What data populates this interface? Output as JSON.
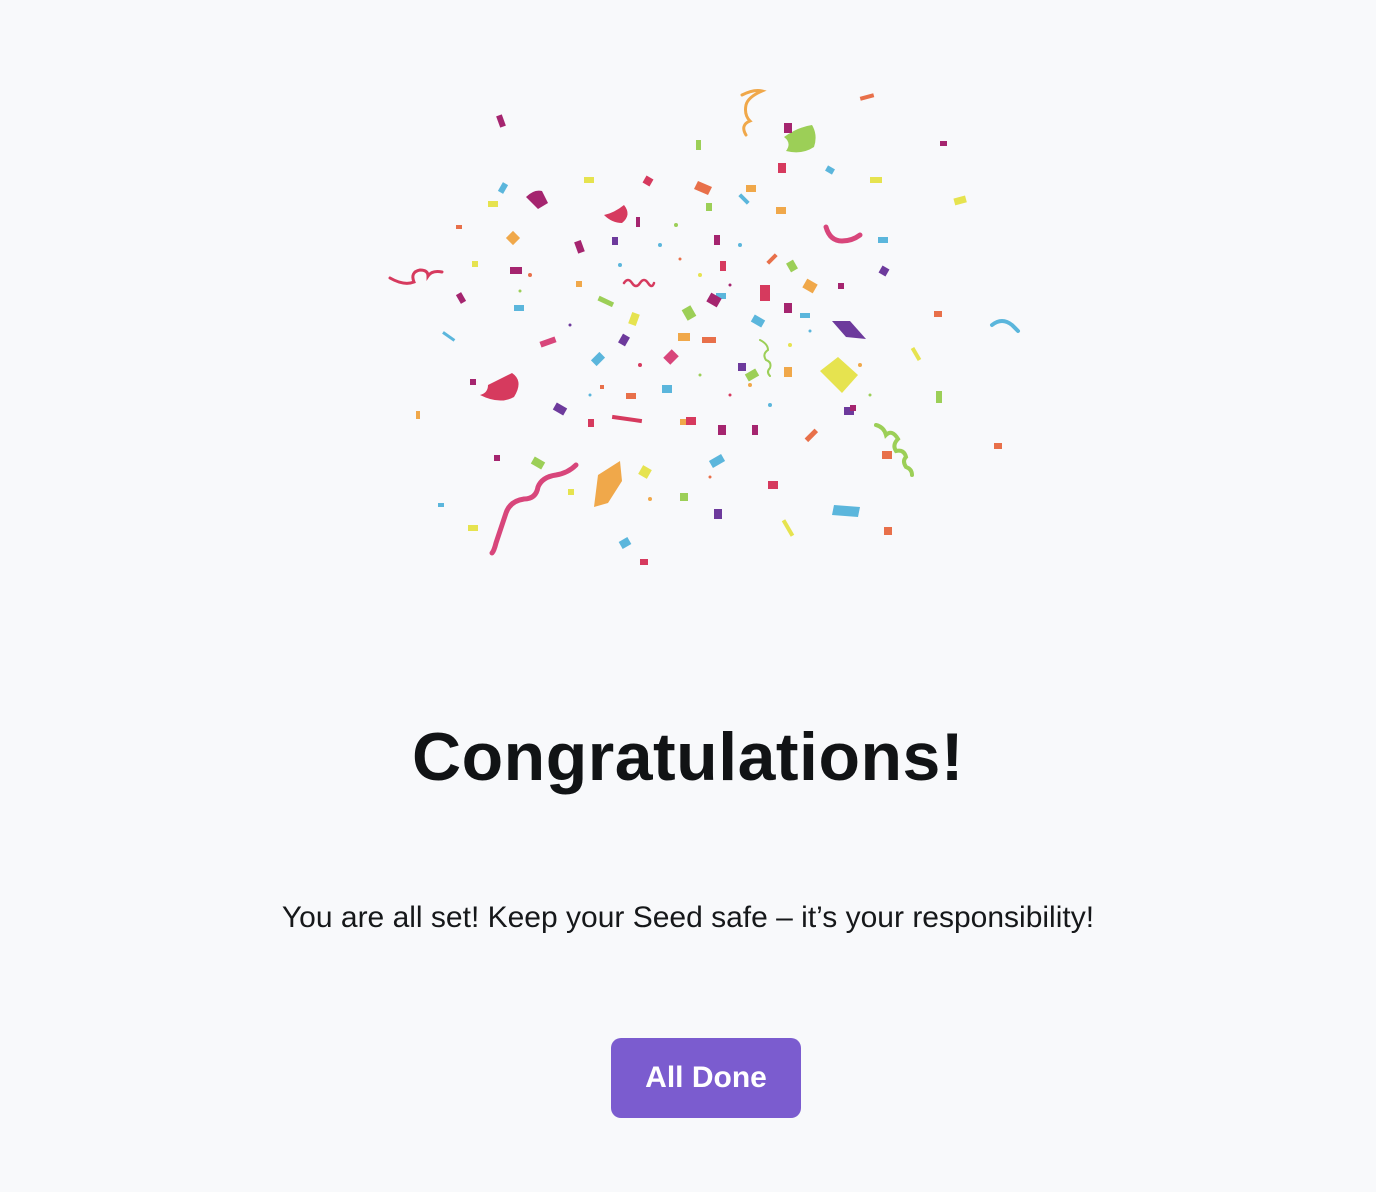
{
  "illustration": {
    "name": "confetti-illustration",
    "colors": [
      "#d63a5e",
      "#a5256f",
      "#6d3a9c",
      "#5bb6dc",
      "#9ccf57",
      "#e6e34f",
      "#f0a84a",
      "#e8704a"
    ]
  },
  "heading": {
    "title": "Congratulations!",
    "message": "You are all set! Keep your Seed safe – it’s your responsibility!"
  },
  "actions": {
    "done_label": "All Done",
    "accent_color": "#7b5ccf"
  }
}
